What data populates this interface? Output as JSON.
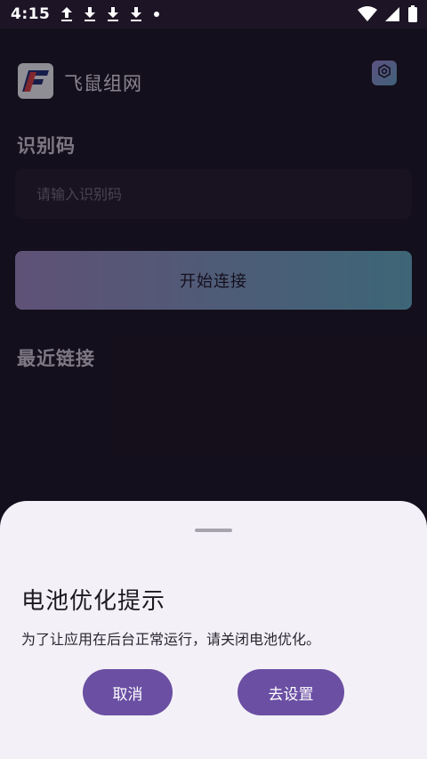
{
  "status_bar": {
    "time": "4:15",
    "icons": [
      "upload-icon",
      "download-icon",
      "download-icon",
      "download-icon",
      "dot-icon",
      "wifi-icon",
      "signal-icon",
      "battery-icon"
    ]
  },
  "header": {
    "logo_letter": "F",
    "title": "飞鼠组网",
    "settings_icon": "settings-hexagon-icon"
  },
  "form": {
    "code_label": "识别码",
    "code_placeholder": "请输入识别码",
    "code_value": "",
    "connect_label": "开始连接"
  },
  "recent": {
    "title": "最近链接"
  },
  "dialog": {
    "title": "电池优化提示",
    "message": "为了让应用在后台正常运行，请关闭电池优化。",
    "cancel_label": "取消",
    "confirm_label": "去设置"
  },
  "colors": {
    "background": "#1b1424",
    "sheet": "#f4f0f7",
    "accent": "#6a4fa3",
    "gradient_start": "#8d7bb0",
    "gradient_end": "#5a9ab0"
  }
}
